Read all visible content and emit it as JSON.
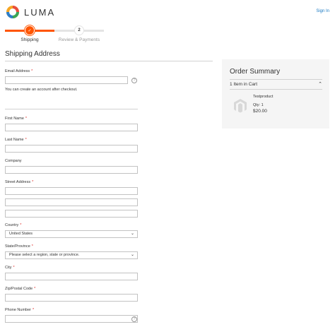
{
  "header": {
    "brand": "LUMA",
    "signin": "Sign In"
  },
  "progress": {
    "steps": [
      {
        "label": "Shipping",
        "marker": "✓"
      },
      {
        "label": "Review & Payments",
        "marker": "2"
      }
    ]
  },
  "shipping": {
    "title": "Shipping Address",
    "email_label": "Email Address",
    "required_mark": "*",
    "email_hint": "You can create an account after checkout.",
    "help_glyph": "?",
    "first_name_label": "First Name",
    "last_name_label": "Last Name",
    "company_label": "Company",
    "street_label": "Street Address",
    "country_label": "Country",
    "country_value": "United States",
    "state_label": "State/Province",
    "state_value": "Please select a region, state or province.",
    "city_label": "City",
    "zip_label": "Zip/Postal Code",
    "phone_label": "Phone Number"
  },
  "summary": {
    "title": "Order Summary",
    "cart_count": "1 Item in Cart",
    "product_name": "Testproduct",
    "qty_text": "Qty: 1",
    "price": "$20.00"
  },
  "colors": {
    "accent": "#ff5501",
    "link": "#1979c3",
    "required": "#e02b27"
  }
}
